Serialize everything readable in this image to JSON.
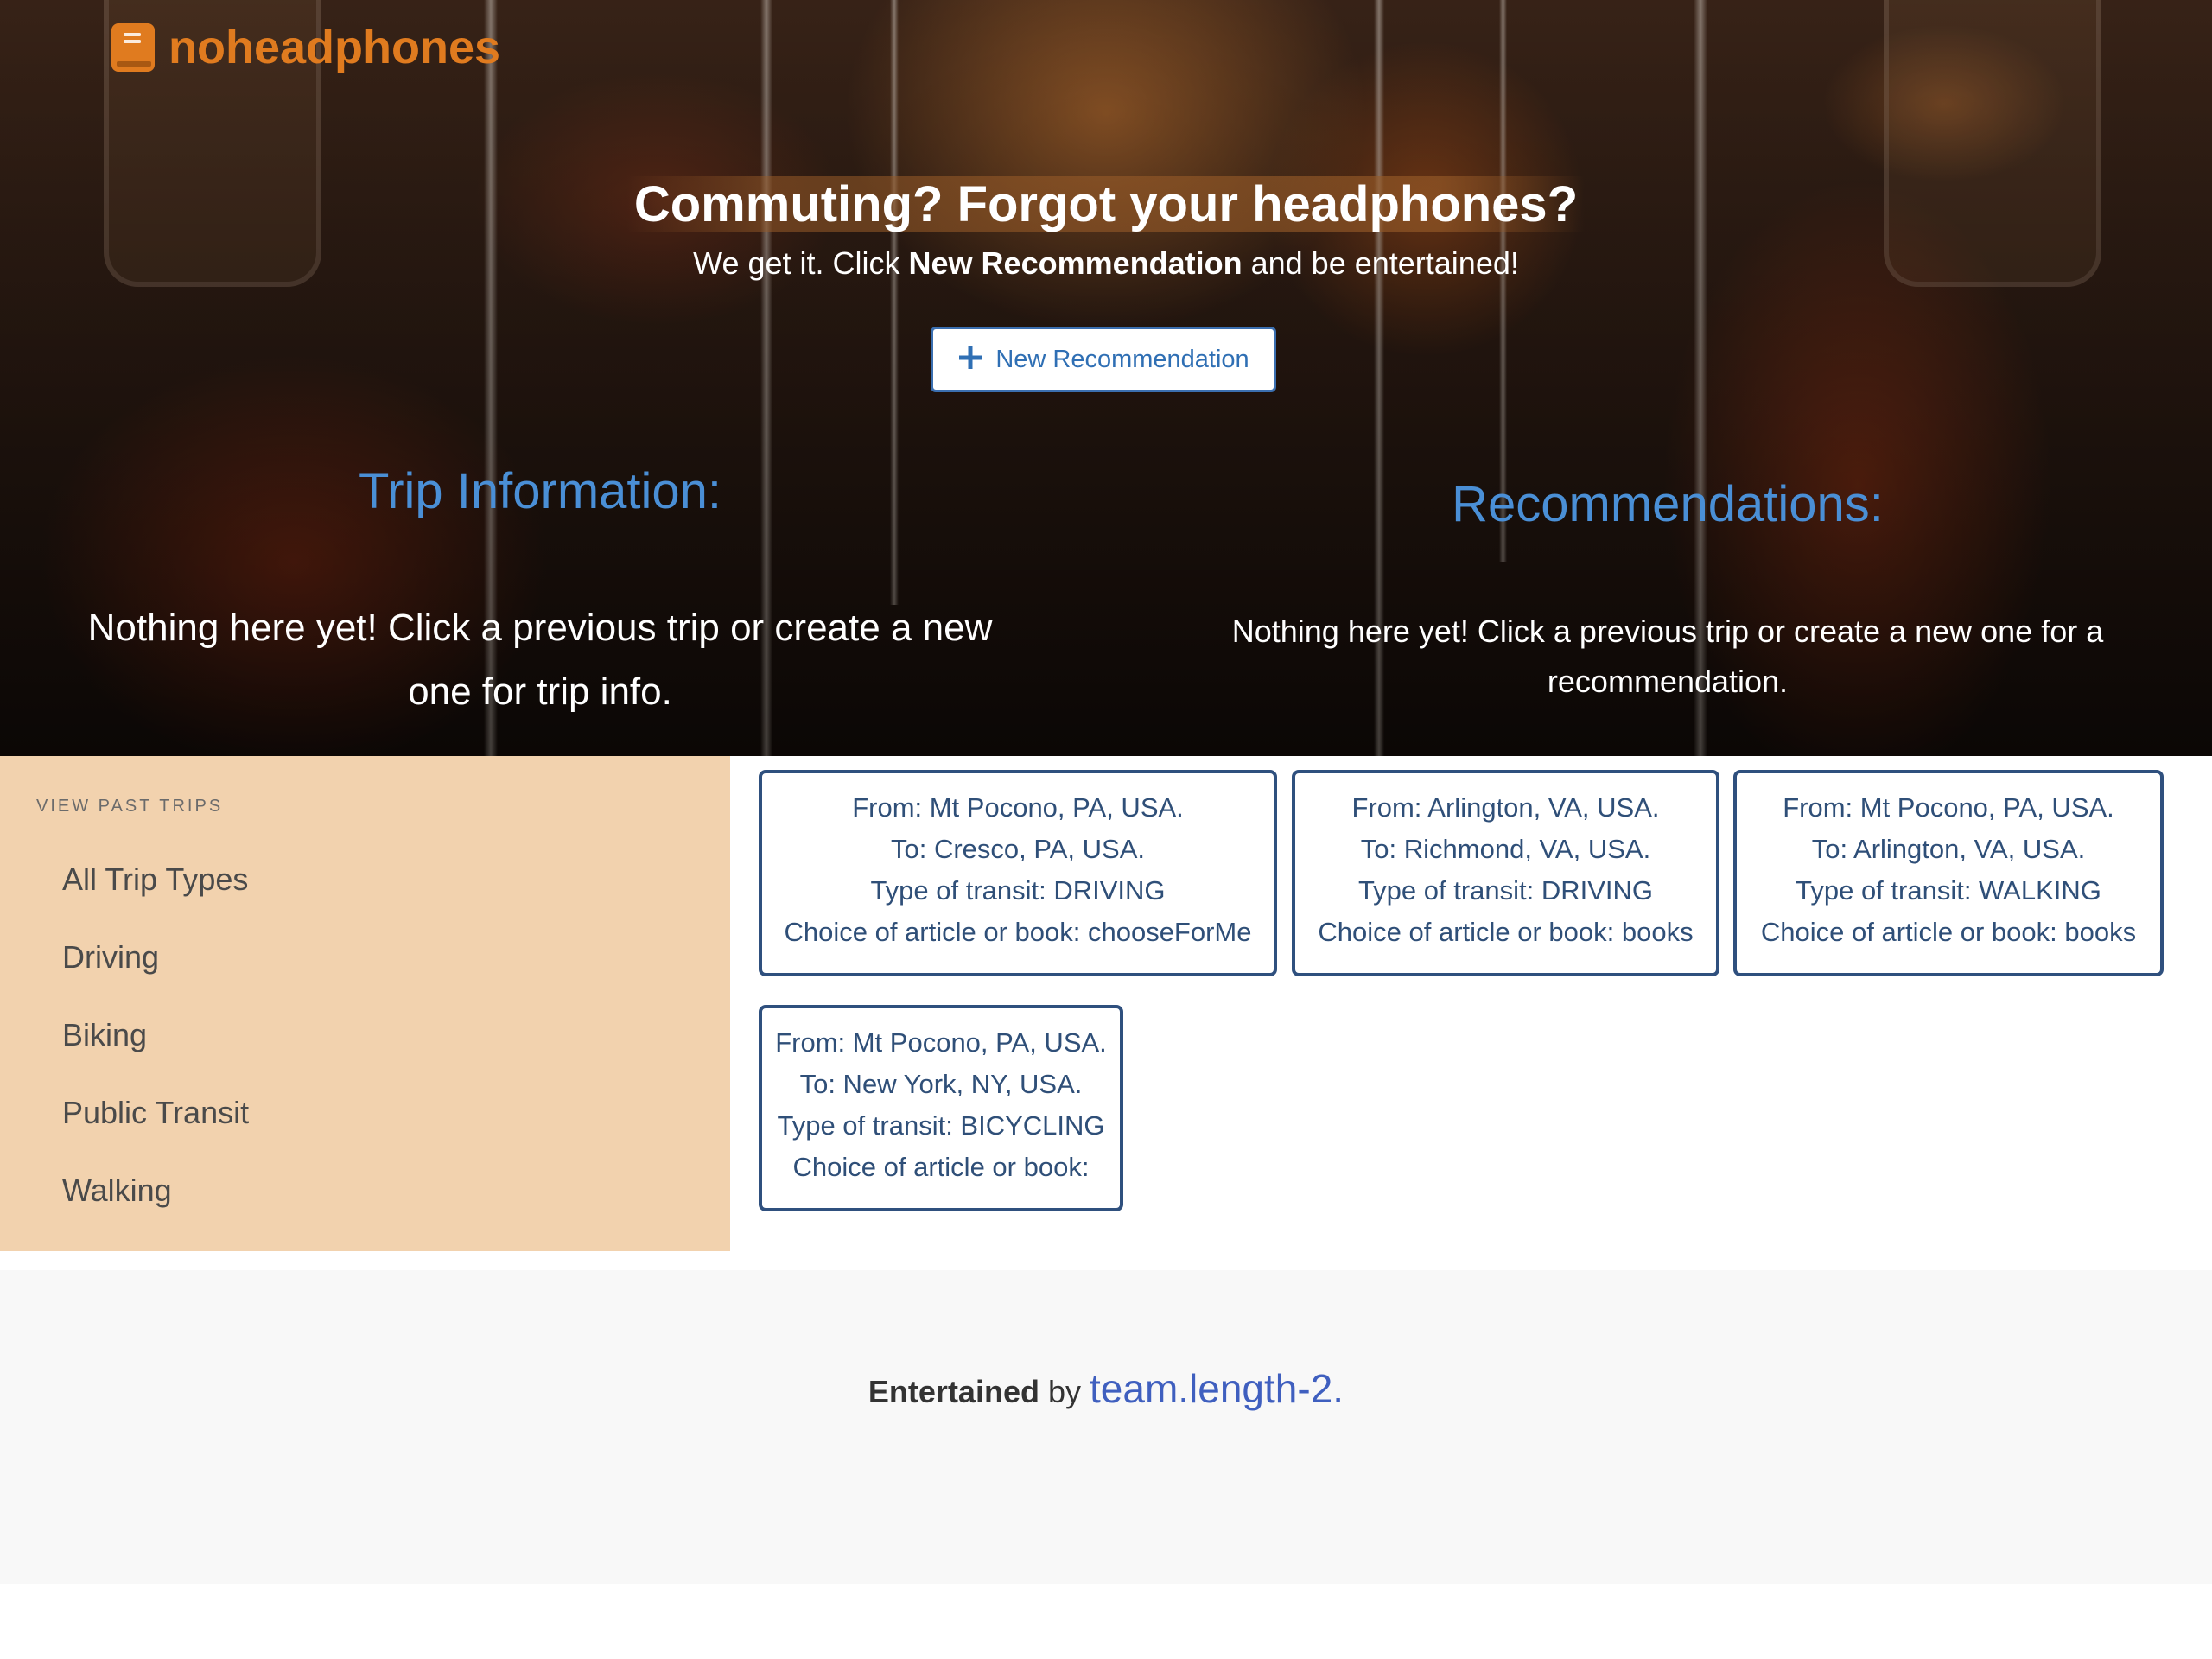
{
  "brand": {
    "name": "noheadphones",
    "icon": "book-icon",
    "color": "#e07b1f"
  },
  "hero": {
    "title": "Commuting? Forgot your headphones?",
    "subtitle_pre": "We get it. Click ",
    "subtitle_bold": "New Recommendation",
    "subtitle_post": " and be entertained!",
    "button_label": "New Recommendation",
    "button_icon": "plus-icon"
  },
  "trip_info": {
    "title": "Trip Information:",
    "empty_text": "Nothing here yet! Click a previous trip or create a new one for trip info."
  },
  "recommendations": {
    "title": "Recommendations:",
    "empty_text": "Nothing here yet! Click a previous trip or create a new one for a recommendation."
  },
  "sidebar": {
    "title": "VIEW PAST TRIPS",
    "items": [
      "All Trip Types",
      "Driving",
      "Biking",
      "Public Transit",
      "Walking"
    ]
  },
  "trips": [
    {
      "from": "From: Mt Pocono, PA, USA.",
      "to": "To: Cresco, PA, USA.",
      "transit": "Type of transit: DRIVING",
      "choice": "Choice of article or book: chooseForMe"
    },
    {
      "from": "From: Arlington, VA, USA.",
      "to": "To: Richmond, VA, USA.",
      "transit": "Type of transit: DRIVING",
      "choice": "Choice of article or book: books"
    },
    {
      "from": "From: Mt Pocono, PA, USA.",
      "to": "To: Arlington, VA, USA.",
      "transit": "Type of transit: WALKING",
      "choice": "Choice of article or book: books"
    },
    {
      "from": "From: Mt Pocono, PA, USA.",
      "to": "To: New York, NY, USA.",
      "transit": "Type of transit: BICYCLING",
      "choice": "Choice of article or book:"
    }
  ],
  "footer": {
    "bold": "Entertained",
    "middle": " by ",
    "link": "team.length-2",
    "end": "."
  },
  "colors": {
    "accent_blue": "#4a8fd6",
    "card_border": "#2f507e",
    "sidebar_bg": "#f2d2ae",
    "footer_link": "#3f5fbf"
  }
}
